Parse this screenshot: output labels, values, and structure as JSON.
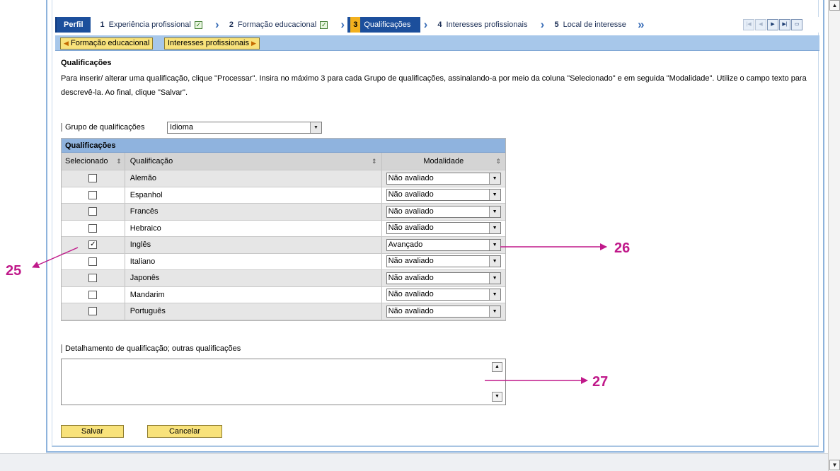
{
  "roadmap": {
    "steps": [
      {
        "num": "",
        "label": "Perfil"
      },
      {
        "num": "1",
        "label": "Experiência profissional",
        "done": true
      },
      {
        "num": "2",
        "label": "Formação educacional",
        "done": true
      },
      {
        "num": "3",
        "label": "Qualificações",
        "active": true
      },
      {
        "num": "4",
        "label": "Interesses profissionais"
      },
      {
        "num": "5",
        "label": "Local de interesse"
      }
    ]
  },
  "subnav": {
    "prev_label": "Formação educacional",
    "next_label": "Interesses profissionais"
  },
  "section": {
    "title": "Qualificações",
    "description": "Para inserir/ alterar uma qualificação, clique \"Processar\". Insira no máximo 3 para cada Grupo de qualificações, assinalando-a por meio da coluna \"Selecionado\" e em seguida \"Modalidade\". Utilize o campo texto para descrevê-la. Ao final, clique \"Salvar\"."
  },
  "group": {
    "label": "Grupo de qualificações",
    "value": "Idioma"
  },
  "table": {
    "caption": "Qualificações",
    "headers": {
      "selected": "Selecionado",
      "qualification": "Qualificação",
      "modality": "Modalidade"
    },
    "rows": [
      {
        "name": "Alemão",
        "checked": false,
        "modality": "Não avaliado"
      },
      {
        "name": "Espanhol",
        "checked": false,
        "modality": "Não avaliado"
      },
      {
        "name": "Francês",
        "checked": false,
        "modality": "Não avaliado"
      },
      {
        "name": "Hebraico",
        "checked": false,
        "modality": "Não avaliado"
      },
      {
        "name": "Inglês",
        "checked": true,
        "modality": "Avançado"
      },
      {
        "name": "Italiano",
        "checked": false,
        "modality": "Não avaliado"
      },
      {
        "name": "Japonês",
        "checked": false,
        "modality": "Não avaliado"
      },
      {
        "name": "Mandarim",
        "checked": false,
        "modality": "Não avaliado"
      },
      {
        "name": "Português",
        "checked": false,
        "modality": "Não avaliado"
      }
    ]
  },
  "detail": {
    "label": "Detalhamento de qualificação; outras qualificações",
    "value": ""
  },
  "actions": {
    "save": "Salvar",
    "cancel": "Cancelar"
  },
  "annotations": {
    "a25": "25",
    "a26": "26",
    "a27": "27",
    "color": "#c0198a"
  }
}
